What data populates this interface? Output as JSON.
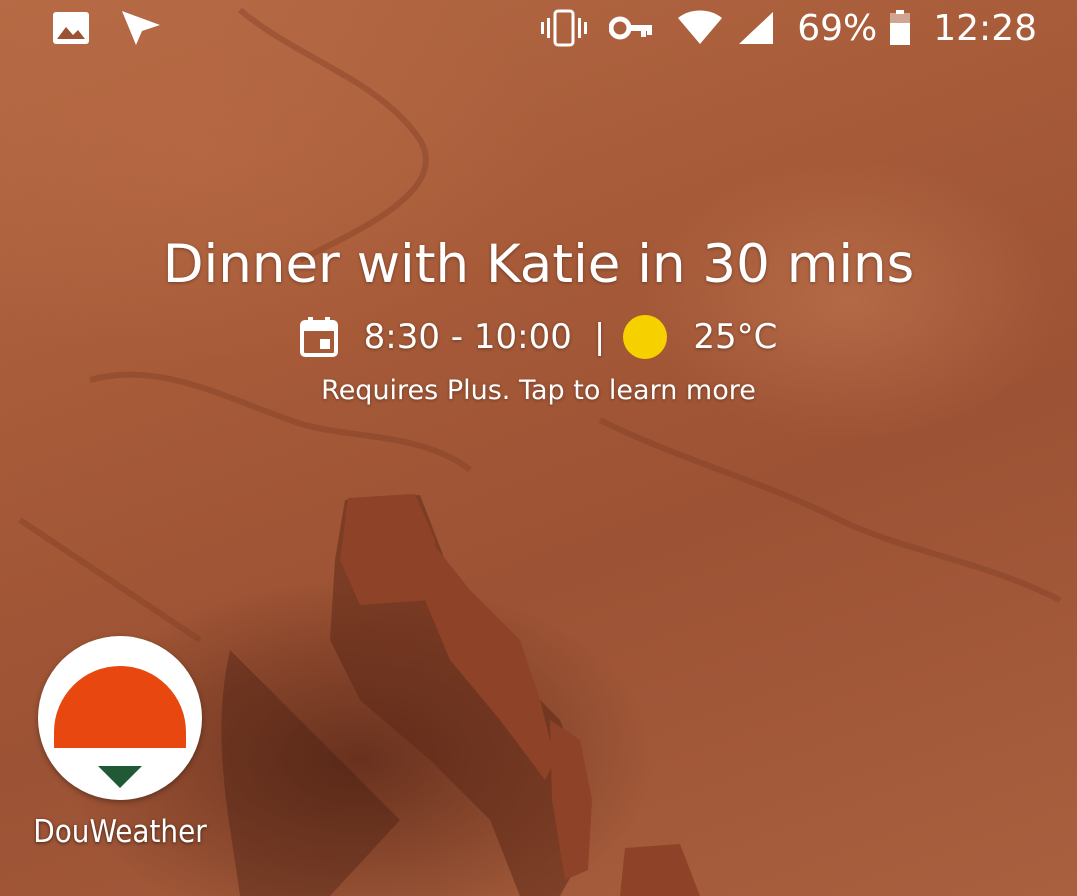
{
  "status_bar": {
    "left_icons": [
      "image-notification-icon",
      "send-notification-icon"
    ],
    "right_icons": [
      "vibrate-icon",
      "vpn-key-icon",
      "wifi-icon",
      "cell-signal-icon"
    ],
    "battery": "69%",
    "time": "12:28"
  },
  "glance": {
    "title": "Dinner with Katie in 30 mins",
    "time_range": "8:30 - 10:00",
    "separator": "|",
    "temperature": "25°C",
    "note": "Requires Plus. Tap to learn more",
    "sun_color": "#f7d000"
  },
  "apps": [
    {
      "label": "DouWeather",
      "icon": "douweather-icon",
      "colors": {
        "top": "#e8470f",
        "bottom": "#1f5a34"
      }
    }
  ]
}
